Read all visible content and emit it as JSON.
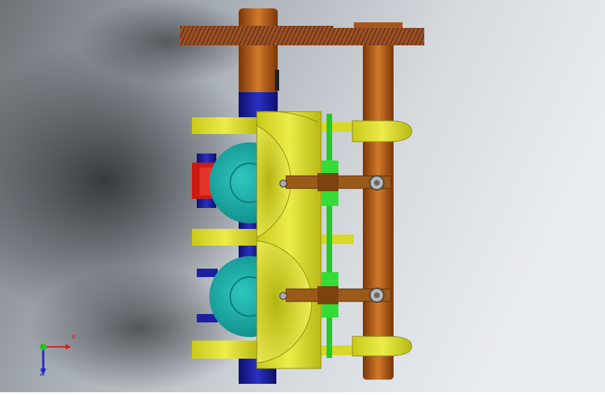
{
  "viewport": {
    "background_colors": [
      "#7d8288",
      "#aeb4bb",
      "#d9dde2",
      "#e7eaed"
    ],
    "model_colors": {
      "shaft_copper": "#b85a13",
      "gear": "#8f4a24",
      "housing_yellow": "#d8d82a",
      "wheel_teal": "#16a8a4",
      "blue_shaft": "#1b1fa0",
      "red_block": "#d21a14",
      "green_rod": "#2cd22c",
      "lever_brown": "#9a5a1a"
    }
  },
  "triad": {
    "x_label": "X",
    "z_label": "Z",
    "icons": [
      "x-axis-arrow-icon",
      "y-axis-dot-icon",
      "z-axis-arrow-icon"
    ]
  }
}
